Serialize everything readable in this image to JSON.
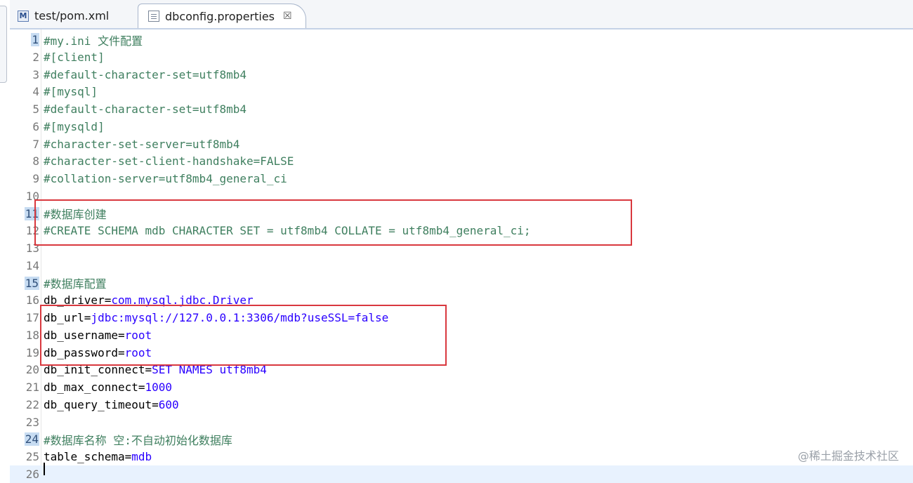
{
  "tabs": [
    {
      "label": "test/pom.xml",
      "icon": "maven-file-icon",
      "active": false
    },
    {
      "label": "dbconfig.properties",
      "icon": "properties-file-icon",
      "active": true,
      "close": "☒"
    }
  ],
  "lines": [
    {
      "n": "1",
      "mark": true,
      "segs": [
        [
          "c-comment",
          "#my.ini 文件配置"
        ]
      ]
    },
    {
      "n": "2",
      "segs": [
        [
          "c-comment",
          "#[client]"
        ]
      ]
    },
    {
      "n": "3",
      "segs": [
        [
          "c-comment",
          "#default-character-set=utf8mb4"
        ]
      ]
    },
    {
      "n": "4",
      "segs": [
        [
          "c-comment",
          "#[mysql]"
        ]
      ]
    },
    {
      "n": "5",
      "segs": [
        [
          "c-comment",
          "#default-character-set=utf8mb4"
        ]
      ]
    },
    {
      "n": "6",
      "segs": [
        [
          "c-comment",
          "#[mysqld]"
        ]
      ]
    },
    {
      "n": "7",
      "segs": [
        [
          "c-comment",
          "#character-set-server=utf8mb4"
        ]
      ]
    },
    {
      "n": "8",
      "segs": [
        [
          "c-comment",
          "#character-set-client-handshake=FALSE"
        ]
      ]
    },
    {
      "n": "9",
      "segs": [
        [
          "c-comment",
          "#collation-server=utf8mb4_general_ci"
        ]
      ]
    },
    {
      "n": "10",
      "segs": []
    },
    {
      "n": "11",
      "mark": true,
      "segs": [
        [
          "c-comment",
          "#数据库创建"
        ]
      ]
    },
    {
      "n": "12",
      "segs": [
        [
          "c-comment",
          "#CREATE SCHEMA mdb CHARACTER SET = utf8mb4 COLLATE = utf8mb4_general_ci;"
        ]
      ]
    },
    {
      "n": "13",
      "segs": []
    },
    {
      "n": "14",
      "segs": []
    },
    {
      "n": "15",
      "mark": true,
      "segs": [
        [
          "c-comment",
          "#数据库配置"
        ]
      ]
    },
    {
      "n": "16",
      "segs": [
        [
          "c-key",
          "db_driver="
        ],
        [
          "c-val",
          "com.mysql.jdbc.Driver"
        ]
      ]
    },
    {
      "n": "17",
      "segs": [
        [
          "c-key",
          "db_url="
        ],
        [
          "c-val",
          "jdbc:mysql://127.0.0.1:3306/mdb?useSSL=false"
        ]
      ]
    },
    {
      "n": "18",
      "segs": [
        [
          "c-key",
          "db_username="
        ],
        [
          "c-val",
          "root"
        ]
      ]
    },
    {
      "n": "19",
      "segs": [
        [
          "c-key",
          "db_password="
        ],
        [
          "c-val",
          "root"
        ]
      ]
    },
    {
      "n": "20",
      "segs": [
        [
          "c-key",
          "db_init_connect="
        ],
        [
          "c-val",
          "SET NAMES utf8mb4"
        ]
      ]
    },
    {
      "n": "21",
      "segs": [
        [
          "c-key",
          "db_max_connect="
        ],
        [
          "c-val",
          "1000"
        ]
      ]
    },
    {
      "n": "22",
      "segs": [
        [
          "c-key",
          "db_query_timeout="
        ],
        [
          "c-val",
          "600"
        ]
      ]
    },
    {
      "n": "23",
      "segs": []
    },
    {
      "n": "24",
      "mark": true,
      "segs": [
        [
          "c-comment",
          "#数据库名称 空:不自动初始化数据库"
        ]
      ]
    },
    {
      "n": "25",
      "segs": [
        [
          "c-key",
          "table_schema="
        ],
        [
          "c-val",
          "mdb"
        ]
      ]
    },
    {
      "n": "26",
      "current": true,
      "segs": []
    }
  ],
  "watermark": "@稀土掘金技术社区",
  "colors": {
    "highlight_box": "#d9383e",
    "comment": "#3f7f5f",
    "value": "#2a00ff"
  }
}
